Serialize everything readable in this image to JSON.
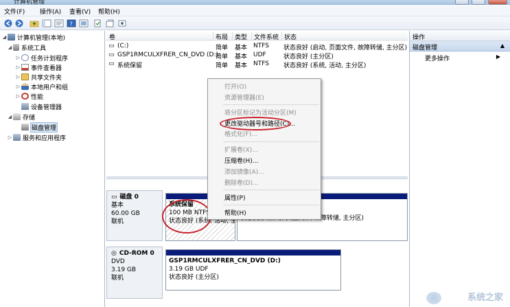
{
  "window": {
    "title": "计算机管理"
  },
  "menu": [
    "文件(F)",
    "操作(A)",
    "查看(V)",
    "帮助(H)"
  ],
  "tree": {
    "root": "计算机管理(本地)",
    "system_tools": "系统工具",
    "task_scheduler": "任务计划程序",
    "event_viewer": "事件查看器",
    "shared_folders": "共享文件夹",
    "local_users": "本地用户和组",
    "performance": "性能",
    "device_manager": "设备管理器",
    "storage": "存储",
    "disk_management": "磁盘管理",
    "services_apps": "服务和应用程序"
  },
  "columns": {
    "volume": "卷",
    "layout": "布局",
    "type": "类型",
    "fs": "文件系统",
    "status": "状态"
  },
  "volumes": [
    {
      "name": "(C:)",
      "layout": "简单",
      "type": "基本",
      "fs": "NTFS",
      "status": "状态良好 (启动, 页面文件, 故障转储, 主分区)"
    },
    {
      "name": "GSP1RMCULXFRER_CN_DVD (D:)",
      "layout": "简单",
      "type": "基本",
      "fs": "UDF",
      "status": "状态良好 (主分区)"
    },
    {
      "name": "系统保留",
      "layout": "简单",
      "type": "基本",
      "fs": "NTFS",
      "status": "状态良好 (系统, 活动, 主分区)"
    }
  ],
  "disk0": {
    "name": "磁盘 0",
    "kind": "基本",
    "size": "60.00 GB",
    "state": "联机",
    "p1_name": "系统保留",
    "p1_size": "100 MB NTFS",
    "p1_status": "状态良好 (系统, 活动, 主",
    "p2_status": "状态良好 (启动, 页面文件, 故障转储, 主分区)"
  },
  "cdrom0": {
    "name": "CD-ROM 0",
    "kind": "DVD",
    "size": "3.19 GB",
    "state": "联机",
    "p_name": "GSP1RMCULXFRER_CN_DVD  (D:)",
    "p_size": "3.19 GB UDF",
    "p_status": "状态良好 (主分区)"
  },
  "context_menu": {
    "open": "打开(O)",
    "explore": "资源管理器(E)",
    "mark_active": "将分区标记为活动分区(M)",
    "change_letter": "更改驱动器号和路径(C)...",
    "format": "格式化(F)...",
    "extend": "扩展卷(X)...",
    "shrink": "压缩卷(H)...",
    "add_mirror": "添加镜像(A)...",
    "delete": "删除卷(D)...",
    "properties": "属性(P)",
    "help": "帮助(H)"
  },
  "actions": {
    "header": "操作",
    "section": "磁盘管理",
    "more": "更多操作"
  },
  "watermark": "系统之家",
  "colors": {
    "partition_bar": "#0a1c7a",
    "highlight_circle": "#c8232c"
  }
}
